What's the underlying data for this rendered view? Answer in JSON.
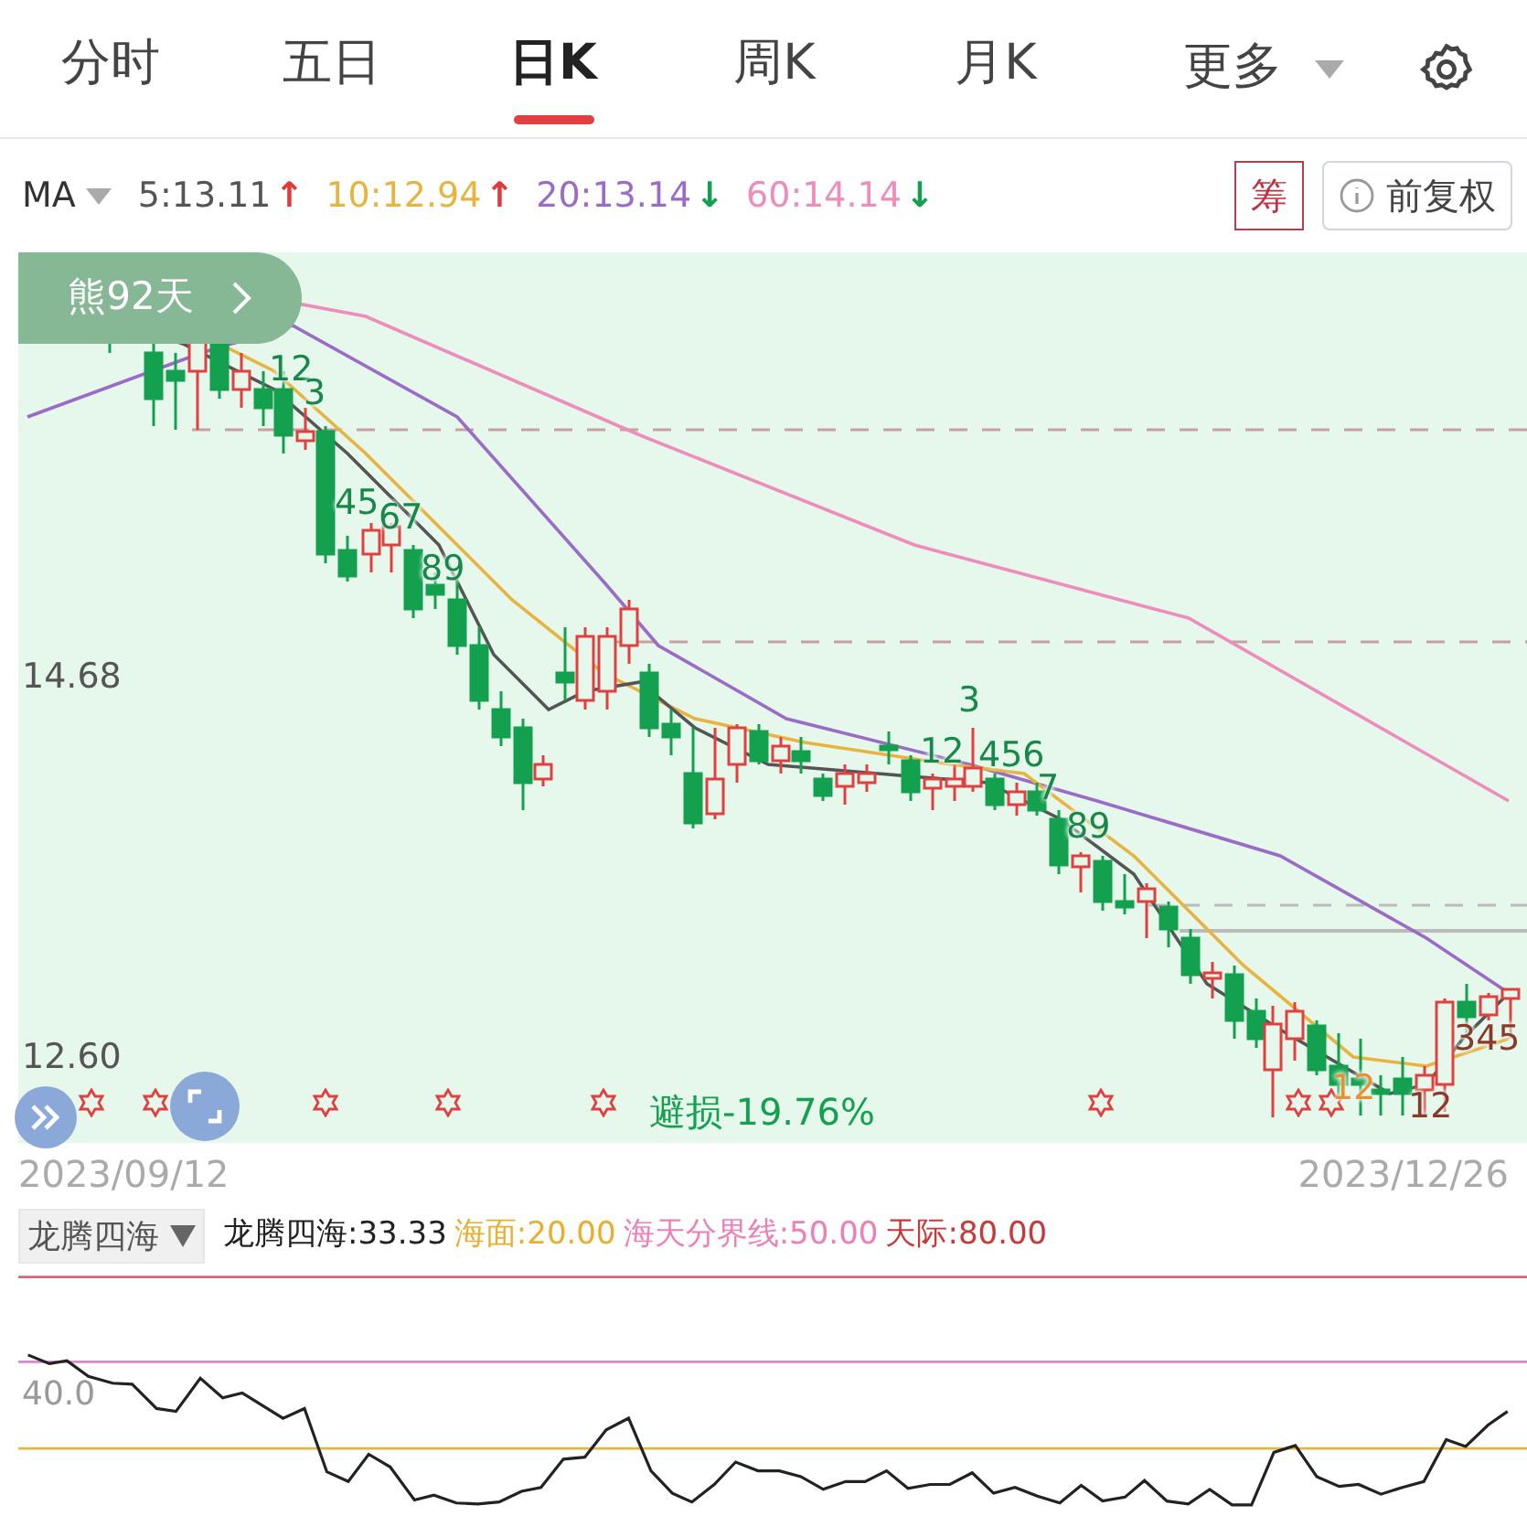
{
  "tabs": [
    {
      "label": "分时",
      "selected": false
    },
    {
      "label": "五日",
      "selected": false
    },
    {
      "label": "日K",
      "selected": true
    },
    {
      "label": "周K",
      "selected": false
    },
    {
      "label": "月K",
      "selected": false
    }
  ],
  "more": {
    "label": "更多"
  },
  "ma": {
    "label": "MA",
    "values": [
      {
        "text": "5:13.11",
        "arrow": "↑",
        "rising": true,
        "color": "#555555"
      },
      {
        "text": "10:12.94",
        "arrow": "↑",
        "rising": true,
        "color": "#e8b440"
      },
      {
        "text": "20:13.14",
        "arrow": "↓",
        "rising": false,
        "color": "#9a6cc8"
      },
      {
        "text": "60:14.14",
        "arrow": "↓",
        "rising": false,
        "color": "#ee8cbc"
      }
    ]
  },
  "chip_button": "筹",
  "adjust_button": "前复权",
  "chart": {
    "badge": "熊92天",
    "price_labels": [
      "14.68",
      "12.60"
    ],
    "marks": [
      {
        "text": "12",
        "color": "#17884a"
      },
      {
        "text": "3",
        "color": "#17884a"
      },
      {
        "text": "45",
        "color": "#17884a"
      },
      {
        "text": "67",
        "color": "#17884a"
      },
      {
        "text": "89",
        "color": "#17884a"
      },
      {
        "text": "3",
        "color": "#17884a"
      },
      {
        "text": "12",
        "color": "#17884a"
      },
      {
        "text": "456",
        "color": "#17884a"
      },
      {
        "text": "7",
        "color": "#17884a"
      },
      {
        "text": "89",
        "color": "#17884a"
      },
      {
        "text": "345",
        "color": "#8a3a2a"
      },
      {
        "text": "12",
        "color": "#8a3a2a"
      },
      {
        "text": "12",
        "color": "#e89030"
      }
    ],
    "stop_loss": "避损-19.76%",
    "start_date": "2023/09/12",
    "end_date": "2023/12/26"
  },
  "indicator": {
    "selector": "龙腾四海",
    "legend": [
      {
        "text": "龙腾四海:33.33",
        "color": "#222222"
      },
      {
        "text": "海面:20.00",
        "color": "#e8b030"
      },
      {
        "text": "海天分界线:50.00",
        "color": "#ee80b8"
      },
      {
        "text": "天际:80.00",
        "color": "#c83a3a"
      }
    ],
    "axis_label": "40.0"
  }
}
